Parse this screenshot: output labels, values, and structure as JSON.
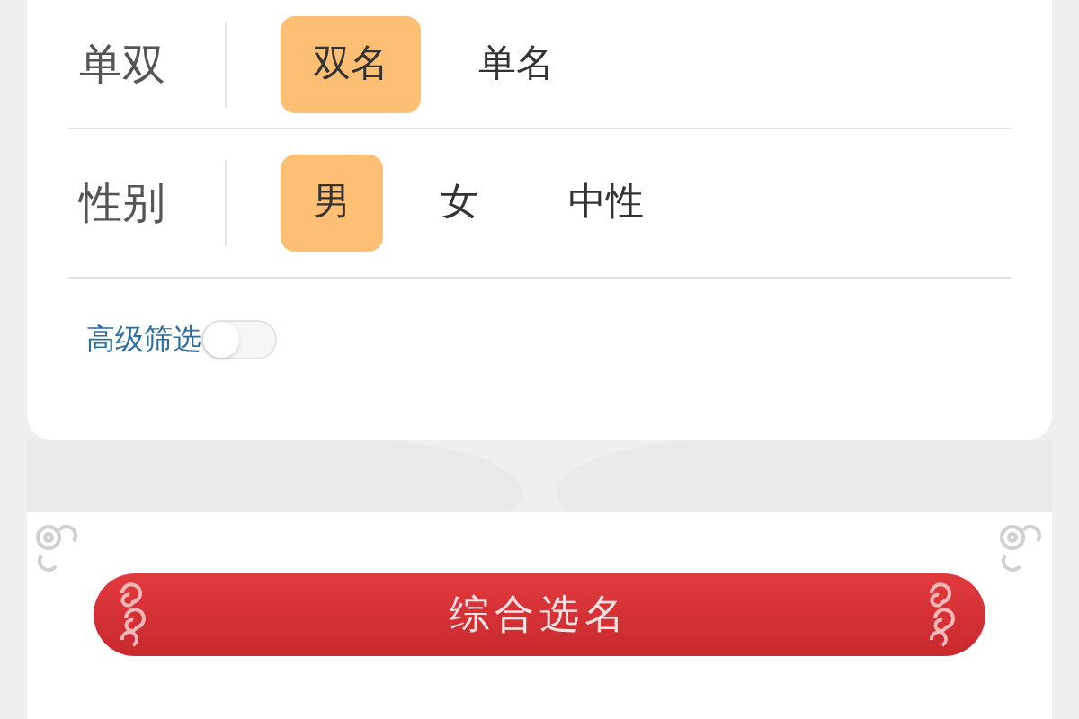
{
  "filters": [
    {
      "label": "单双",
      "options": [
        {
          "label": "双名",
          "selected": true
        },
        {
          "label": "单名",
          "selected": false
        }
      ]
    },
    {
      "label": "性别",
      "options": [
        {
          "label": "男",
          "selected": true
        },
        {
          "label": "女",
          "selected": false
        },
        {
          "label": "中性",
          "selected": false
        }
      ]
    }
  ],
  "advanced_filter": {
    "label": "高级筛选",
    "on": false
  },
  "banner": {
    "title": "综合选名"
  }
}
